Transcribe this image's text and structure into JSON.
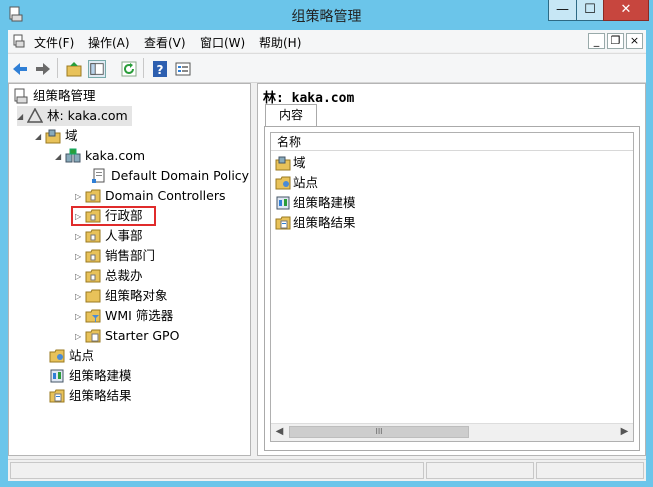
{
  "window": {
    "title": "组策略管理"
  },
  "menu": [
    "文件(F)",
    "操作(A)",
    "查看(V)",
    "窗口(W)",
    "帮助(H)"
  ],
  "mdi_controls": [
    "_",
    "❐",
    "×"
  ],
  "window_controls": {
    "minimize": "—",
    "maximize": "☐",
    "close": "✕"
  },
  "tree": {
    "root": "组策略管理",
    "forest": "林: kaka.com",
    "domains": "域",
    "domain": "kaka.com",
    "default_policy": "Default Domain Policy",
    "children": [
      "Domain Controllers",
      "行政部",
      "人事部",
      "销售部门",
      "总裁办",
      "组策略对象",
      "WMI 筛选器",
      "Starter GPO"
    ],
    "sites": "站点",
    "modeling": "组策略建模",
    "results": "组策略结果"
  },
  "right": {
    "title": "林: kaka.com",
    "tab": "内容",
    "column": "名称",
    "items": [
      "域",
      "站点",
      "组策略建模",
      "组策略结果"
    ],
    "scroll_grip": "III"
  },
  "colors": {
    "highlight_border": "#e02b2b",
    "titlebar": "#6bc5ea"
  }
}
